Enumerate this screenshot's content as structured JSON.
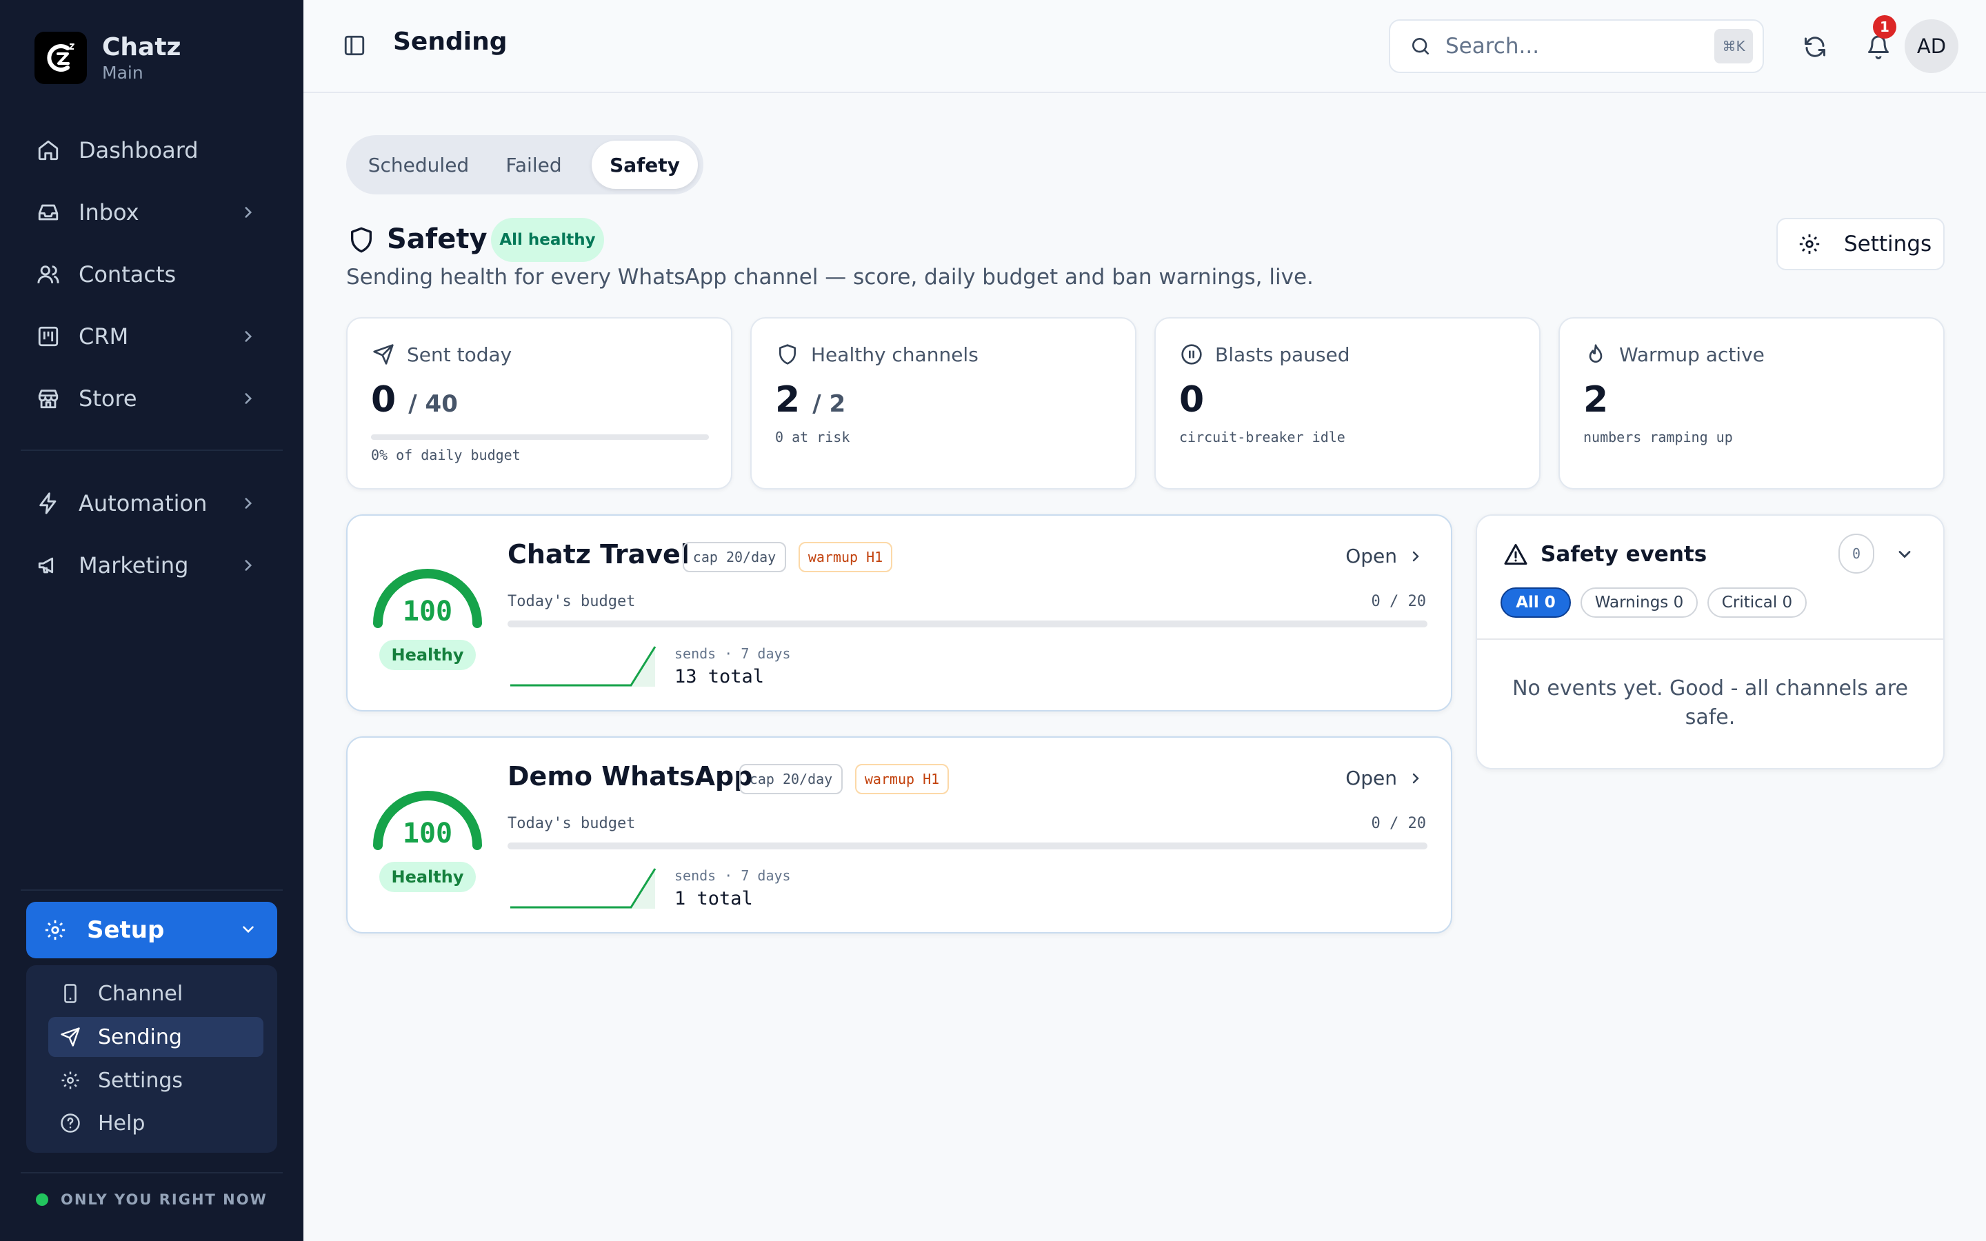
{
  "app": {
    "name": "Chatz",
    "workspace": "Main"
  },
  "sidebar": {
    "items": [
      {
        "label": "Dashboard",
        "icon": "home-icon"
      },
      {
        "label": "Inbox",
        "icon": "inbox-icon"
      },
      {
        "label": "Contacts",
        "icon": "users-icon"
      },
      {
        "label": "CRM",
        "icon": "kanban-icon"
      },
      {
        "label": "Store",
        "icon": "store-icon"
      },
      {
        "label": "Automation",
        "icon": "zap-icon"
      },
      {
        "label": "Marketing",
        "icon": "megaphone-icon"
      }
    ],
    "setup": {
      "label": "Setup",
      "children": [
        {
          "label": "Channel",
          "icon": "phone-icon"
        },
        {
          "label": "Sending",
          "icon": "send-icon",
          "active": true
        },
        {
          "label": "Settings",
          "icon": "gear-icon"
        },
        {
          "label": "Help",
          "icon": "help-icon"
        }
      ]
    },
    "presence": "ONLY YOU RIGHT NOW"
  },
  "header": {
    "title": "Sending",
    "search_placeholder": "Search...",
    "shortcut": "⌘K",
    "notification_count": "1",
    "avatar_initials": "AD"
  },
  "tabs": [
    {
      "label": "Scheduled"
    },
    {
      "label": "Failed"
    },
    {
      "label": "Safety",
      "active": true
    }
  ],
  "safety": {
    "title": "Safety",
    "status_pill": "All healthy",
    "description": "Sending health for every WhatsApp channel — score, daily budget and ban warnings, live.",
    "settings_label": "Settings"
  },
  "stats": [
    {
      "label": "Sent today",
      "icon": "send-icon",
      "value": "0",
      "denominator": "/ 40",
      "note": "0% of daily budget",
      "progress": 0
    },
    {
      "label": "Healthy channels",
      "icon": "shield-icon",
      "value": "2",
      "denominator": "/ 2",
      "note": "0 at risk"
    },
    {
      "label": "Blasts paused",
      "icon": "pause-icon",
      "value": "0",
      "denominator": "",
      "note": "circuit-breaker idle"
    },
    {
      "label": "Warmup active",
      "icon": "flame-icon",
      "value": "2",
      "denominator": "",
      "note": "numbers ramping up"
    }
  ],
  "channels": [
    {
      "name": "Chatz Travel",
      "cap": "cap 20/day",
      "warmup": "warmup H1",
      "score": "100",
      "score_value": 100,
      "status": "Healthy",
      "open_label": "Open",
      "budget_label": "Today's budget",
      "budget_value": "0 / 20",
      "budget_progress": 0,
      "sends_label": "sends · 7 days",
      "sends_total": "13 total",
      "sends_series": [
        0,
        0,
        0,
        0,
        0,
        0,
        13
      ]
    },
    {
      "name": "Demo WhatsApp",
      "cap": "cap 20/day",
      "warmup": "warmup H1",
      "score": "100",
      "score_value": 100,
      "status": "Healthy",
      "open_label": "Open",
      "budget_label": "Today's budget",
      "budget_value": "0 / 20",
      "budget_progress": 0,
      "sends_label": "sends · 7 days",
      "sends_total": "1 total",
      "sends_series": [
        0,
        0,
        0,
        0,
        0,
        0,
        1
      ]
    }
  ],
  "events": {
    "title": "Safety events",
    "count": "0",
    "filters": [
      {
        "label": "All 0",
        "active": true
      },
      {
        "label": "Warnings 0"
      },
      {
        "label": "Critical 0"
      }
    ],
    "empty_text": "No events yet. Good - all channels are safe."
  },
  "colors": {
    "accent": "#1d6de0",
    "healthy": "#16a34a",
    "sidebar": "#121a2e",
    "alert": "#dc2626"
  }
}
